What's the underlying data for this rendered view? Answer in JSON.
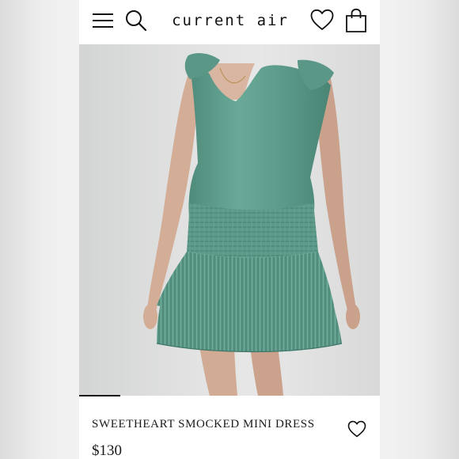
{
  "header": {
    "brand_logo": "current air",
    "menu_icon": "hamburger-menu-icon",
    "search_icon": "search-icon",
    "favorites_icon": "heart-icon",
    "cart_icon": "shopping-bag-icon"
  },
  "product": {
    "name": "SWEETHEART SMOCKED MINI DRESS",
    "price": "$130",
    "dress_color": "#5f9e8d",
    "wishlist_icon": "heart-outline-icon"
  },
  "colors": {
    "page_background": "#ffffff",
    "text": "#1a1a1a"
  }
}
